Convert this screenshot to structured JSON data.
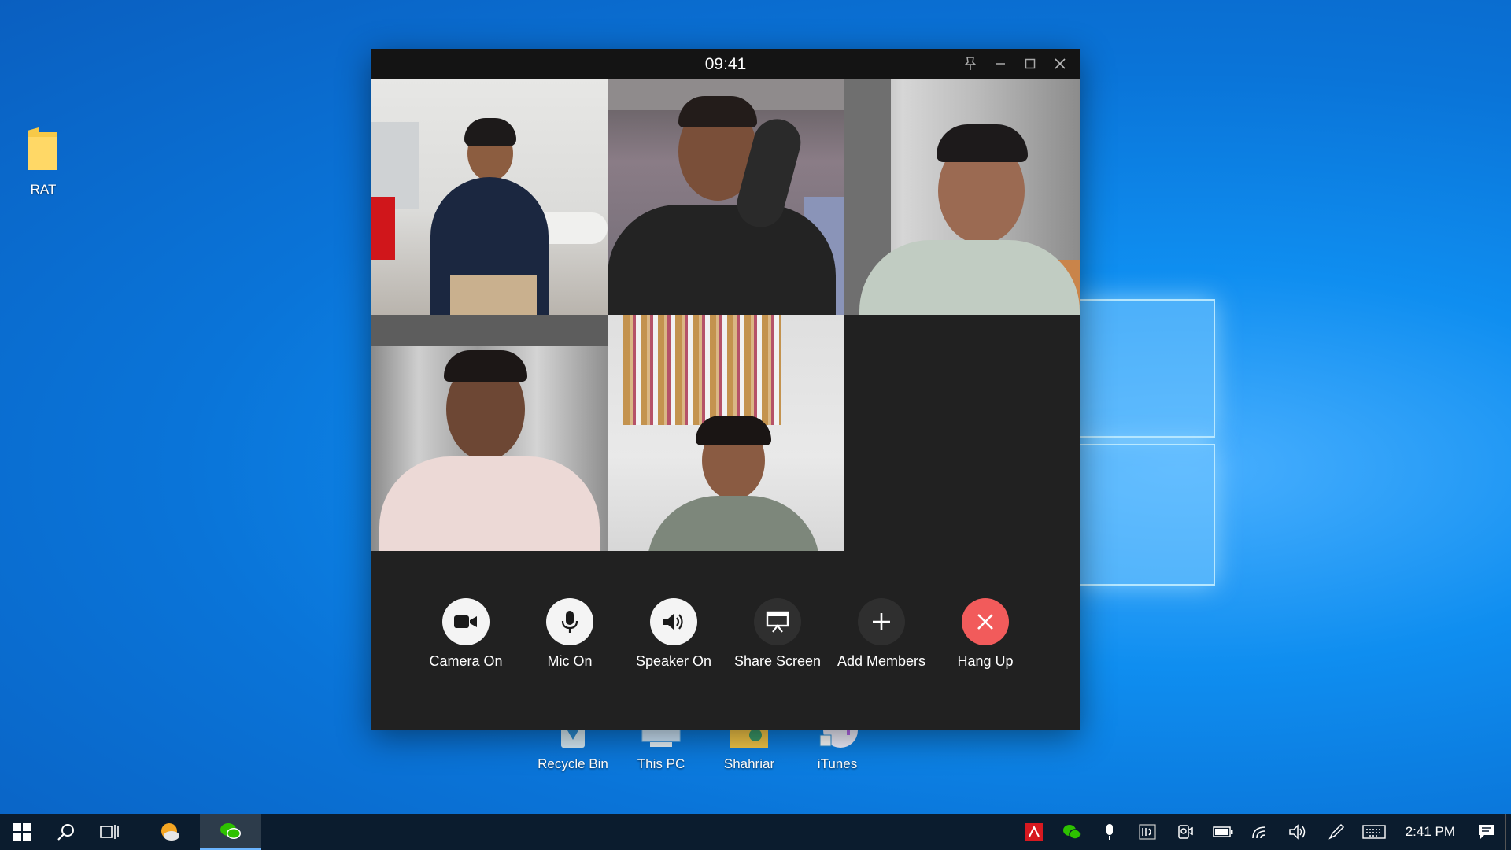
{
  "desktop": {
    "icons": [
      {
        "label": "RAT",
        "icon": "folder-icon"
      },
      {
        "label": "Recycle Bin",
        "icon": "recycle-bin-icon"
      },
      {
        "label": "This PC",
        "icon": "computer-icon"
      },
      {
        "label": "Shahriar",
        "icon": "user-folder-icon"
      },
      {
        "label": "iTunes",
        "icon": "music-note-icon"
      }
    ]
  },
  "call": {
    "time": "09:41",
    "window_controls": [
      "pin-icon",
      "minimize-icon",
      "maximize-icon",
      "close-icon"
    ],
    "participants_count": 5,
    "controls": [
      {
        "label": "Camera On",
        "icon": "camera-icon",
        "style": "white"
      },
      {
        "label": "Mic On",
        "icon": "microphone-icon",
        "style": "white"
      },
      {
        "label": "Speaker On",
        "icon": "speaker-icon",
        "style": "white"
      },
      {
        "label": "Share Screen",
        "icon": "screen-share-icon",
        "style": "dark"
      },
      {
        "label": "Add Members",
        "icon": "plus-icon",
        "style": "dark"
      },
      {
        "label": "Hang Up",
        "icon": "hang-up-icon",
        "style": "red"
      }
    ]
  },
  "taskbar": {
    "clock": "2:41 PM"
  },
  "colors": {
    "hang_up": "#f25b5b",
    "window_bg": "#212121",
    "taskbar_bg": "#0b1c2e"
  }
}
